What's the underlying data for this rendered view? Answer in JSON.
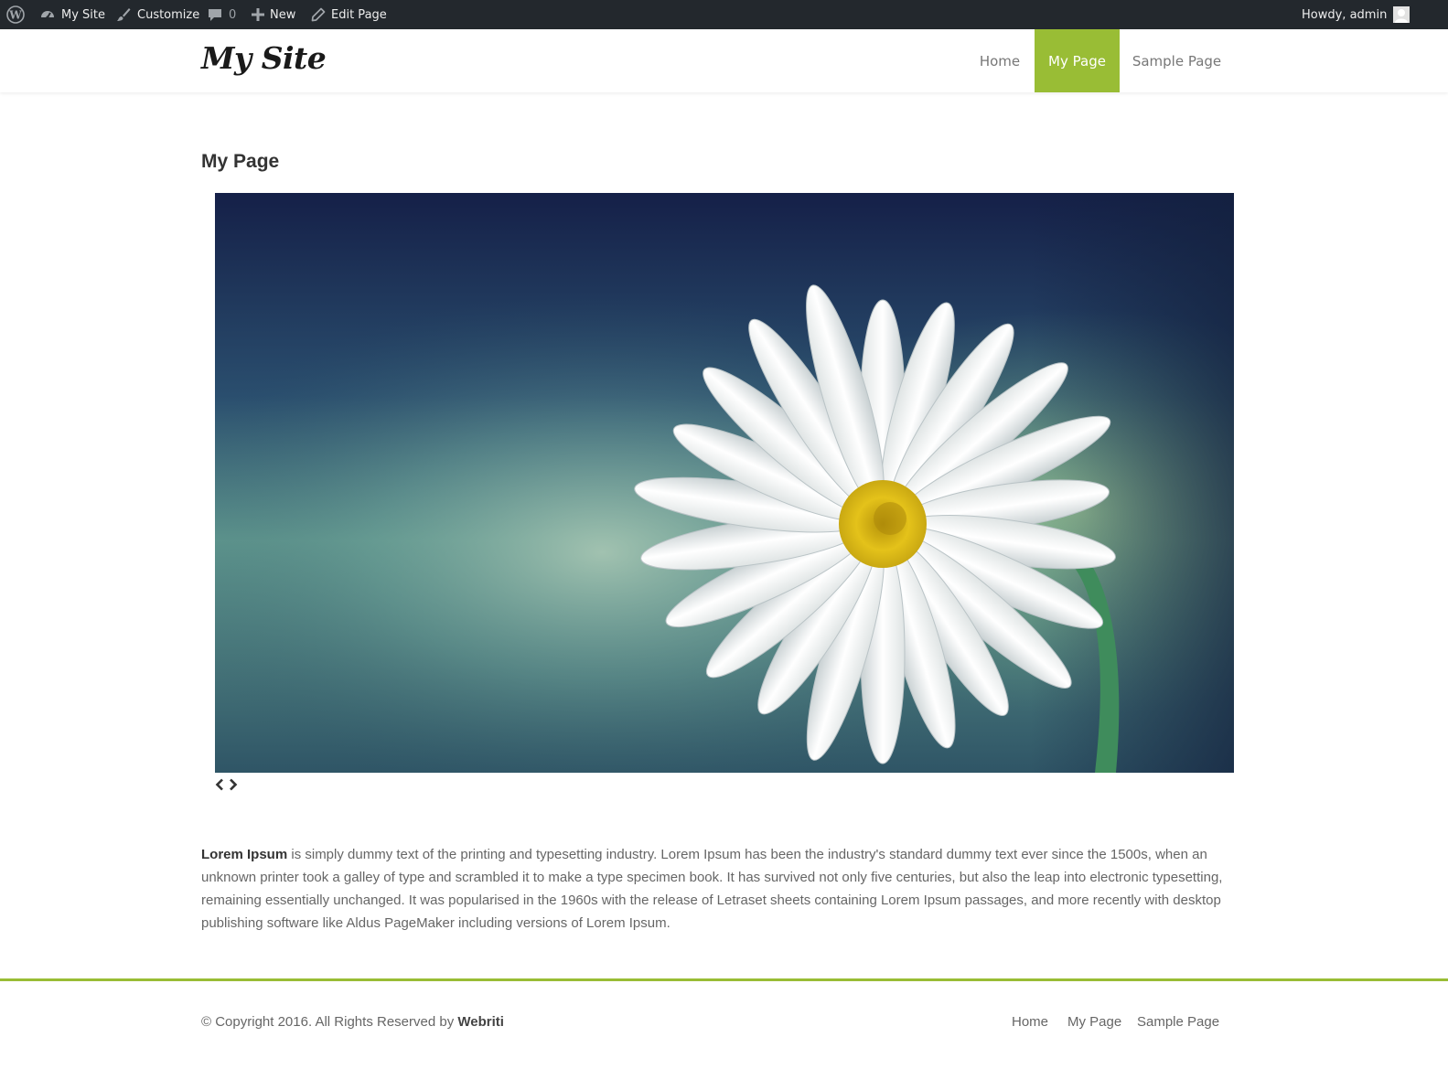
{
  "admin_bar": {
    "site_label": "My Site",
    "customize_label": "Customize",
    "comments_count": "0",
    "new_label": "New",
    "edit_label": "Edit Page",
    "greeting": "Howdy, admin",
    "bg_color": "#23282d"
  },
  "header": {
    "logo_text": "My Site",
    "menu": [
      {
        "label": "Home",
        "active": false
      },
      {
        "label": "My Page",
        "active": true
      },
      {
        "label": "Sample Page",
        "active": false
      }
    ],
    "accent_color": "#99bd35"
  },
  "content": {
    "title": "My Page",
    "slider": {
      "prev_icon": "chevron-left-icon",
      "next_icon": "chevron-right-icon",
      "prev_glyph": "‹",
      "next_glyph": "›"
    },
    "paragraph_lead": "Lorem Ipsum",
    "paragraph_rest": " is simply dummy text of the printing and typesetting industry. Lorem Ipsum has been the industry's standard dummy text ever since the 1500s, when an unknown printer took a galley of type and scrambled it to make a type specimen book. It has survived not only five centuries, but also the leap into electronic typesetting, remaining essentially unchanged. It was popularised in the 1960s with the release of Letraset sheets containing Lorem Ipsum passages, and more recently with desktop publishing software like Aldus PageMaker including versions of Lorem Ipsum."
  },
  "footer": {
    "copyright_prefix": "© Copyright 2016. All Rights Reserved by ",
    "copyright_brand": "Webriti",
    "links": [
      "Home",
      "My Page",
      "Sample Page"
    ],
    "border_color": "#99bd35"
  }
}
